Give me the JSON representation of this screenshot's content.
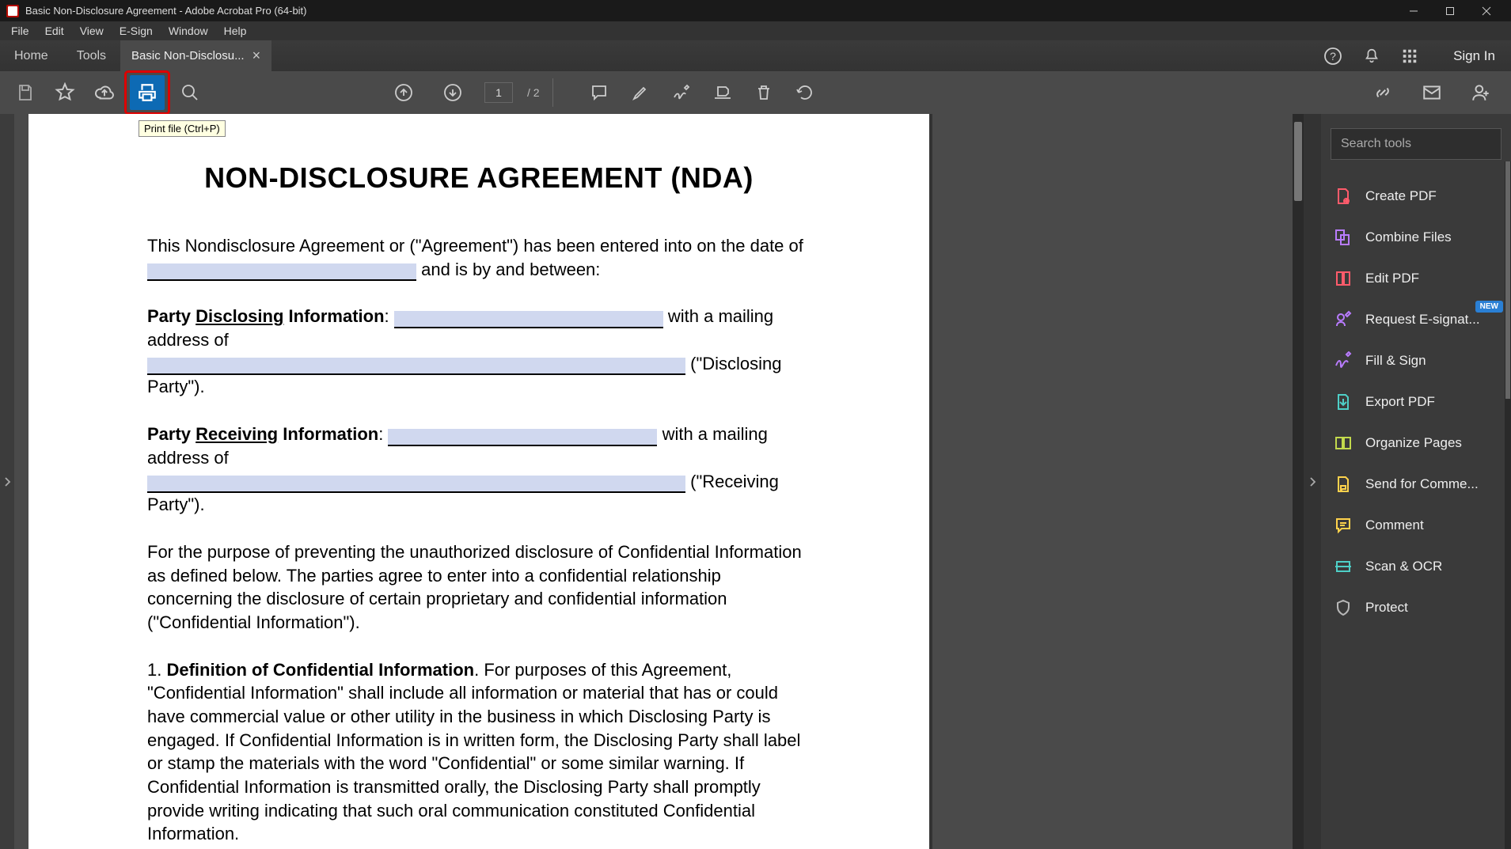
{
  "window": {
    "title": "Basic Non-Disclosure Agreement - Adobe Acrobat Pro (64-bit)"
  },
  "menus": [
    "File",
    "Edit",
    "View",
    "E-Sign",
    "Window",
    "Help"
  ],
  "nav_tabs": {
    "home": "Home",
    "tools": "Tools"
  },
  "doc_tab": {
    "label": "Basic Non-Disclosu...",
    "close": "×"
  },
  "header_right": {
    "sign_in": "Sign In"
  },
  "toolbar": {
    "tooltip": "Print file (Ctrl+P)",
    "page_current": "1",
    "page_total": "/  2"
  },
  "right_panel": {
    "search_placeholder": "Search tools",
    "items": [
      {
        "label": "Create PDF",
        "icon": "create-pdf-icon",
        "color": "#ff5b6b"
      },
      {
        "label": "Combine Files",
        "icon": "combine-icon",
        "color": "#b97cff"
      },
      {
        "label": "Edit PDF",
        "icon": "edit-pdf-icon",
        "color": "#ff5b6b"
      },
      {
        "label": "Request E-signat...",
        "icon": "signature-icon",
        "color": "#b97cff",
        "new": "NEW"
      },
      {
        "label": "Fill & Sign",
        "icon": "fill-sign-icon",
        "color": "#b97cff"
      },
      {
        "label": "Export PDF",
        "icon": "export-icon",
        "color": "#4ecfc7"
      },
      {
        "label": "Organize Pages",
        "icon": "organize-icon",
        "color": "#c2d94c"
      },
      {
        "label": "Send for Comme...",
        "icon": "send-comment-icon",
        "color": "#ffd24c"
      },
      {
        "label": "Comment",
        "icon": "comment-icon",
        "color": "#ffd24c"
      },
      {
        "label": "Scan & OCR",
        "icon": "scan-icon",
        "color": "#4ecfc7"
      },
      {
        "label": "Protect",
        "icon": "protect-icon",
        "color": "#b8b8b8"
      }
    ]
  },
  "document": {
    "title": "NON-DISCLOSURE AGREEMENT (NDA)",
    "p1a": "This Nondisclosure Agreement or (\"Agreement\") has been entered into on the date of",
    "p1b": " and is by and between:",
    "p2a": "Party ",
    "p2b": "Disclosing",
    "p2c": " Information",
    "p2d": ": ",
    "p2e": " with a mailing address of",
    "p2f": " (\"Disclosing Party\").",
    "p3a": "Party ",
    "p3b": "Receiving",
    "p3c": " Information",
    "p3d": ": ",
    "p3e": " with a mailing address of",
    "p3f": " (\"Receiving Party\").",
    "p4": "For the purpose of preventing the unauthorized disclosure of Confidential Information as defined below. The parties agree to enter into a confidential relationship concerning the disclosure of certain proprietary and confidential information (\"Confidential Information\").",
    "p5a": "1. ",
    "p5b": "Definition of Confidential Information",
    "p5c": ". For purposes of this Agreement, \"Confidential Information\" shall include all information or material that has or could have commercial value or other utility in the business in which Disclosing Party is engaged. If Confidential Information is in written form, the Disclosing Party shall label or stamp the materials with the word \"Confidential\" or some similar warning. If Confidential Information is transmitted orally, the Disclosing Party shall promptly provide writing indicating that such oral communication constituted Confidential Information."
  }
}
